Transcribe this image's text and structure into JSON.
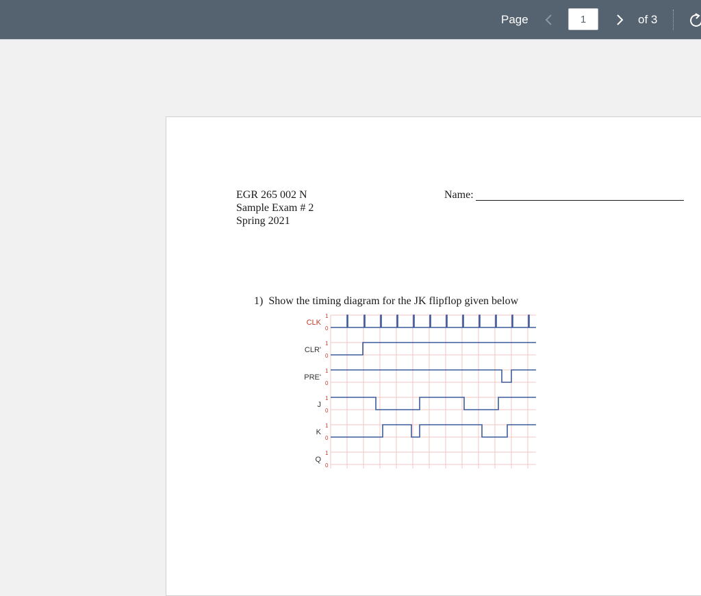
{
  "toolbar": {
    "page_label": "Page",
    "current_page": "1",
    "total_label": "of 3",
    "prev_icon": "chevron-left-icon",
    "next_icon": "chevron-right-icon",
    "rotate_icon": "rotate-icon"
  },
  "document": {
    "course": "EGR 265 002 N",
    "exam": "Sample Exam # 2",
    "term": "Spring 2021",
    "name_label": "Name:",
    "question_number": "1)",
    "question_text": "Show the timing diagram for the JK flipflop given below"
  },
  "timing_diagram": {
    "level_high": "1",
    "level_low": "0",
    "signal_color": "#3b5b9a",
    "label_color_clk": "#c0392b",
    "grid_color": "#f2c4c4",
    "signals": [
      {
        "label": "CLK",
        "initial": 0,
        "transitions": [
          24,
          25,
          49,
          50,
          73,
          74,
          97,
          98,
          121,
          122,
          145,
          146,
          169,
          170,
          193,
          194,
          217,
          218,
          241,
          242,
          265,
          266,
          289,
          290
        ]
      },
      {
        "label": "CLR'",
        "initial": 0,
        "transitions": [
          47
        ]
      },
      {
        "label": "PRE'",
        "initial": 1,
        "transitions": [
          250,
          264
        ]
      },
      {
        "label": "J",
        "initial": 1,
        "transitions": [
          66,
          130,
          195,
          245
        ]
      },
      {
        "label": "K",
        "initial": 0,
        "transitions": [
          76,
          118,
          130,
          221,
          258
        ]
      },
      {
        "label": "Q",
        "initial": null,
        "transitions": []
      }
    ]
  }
}
